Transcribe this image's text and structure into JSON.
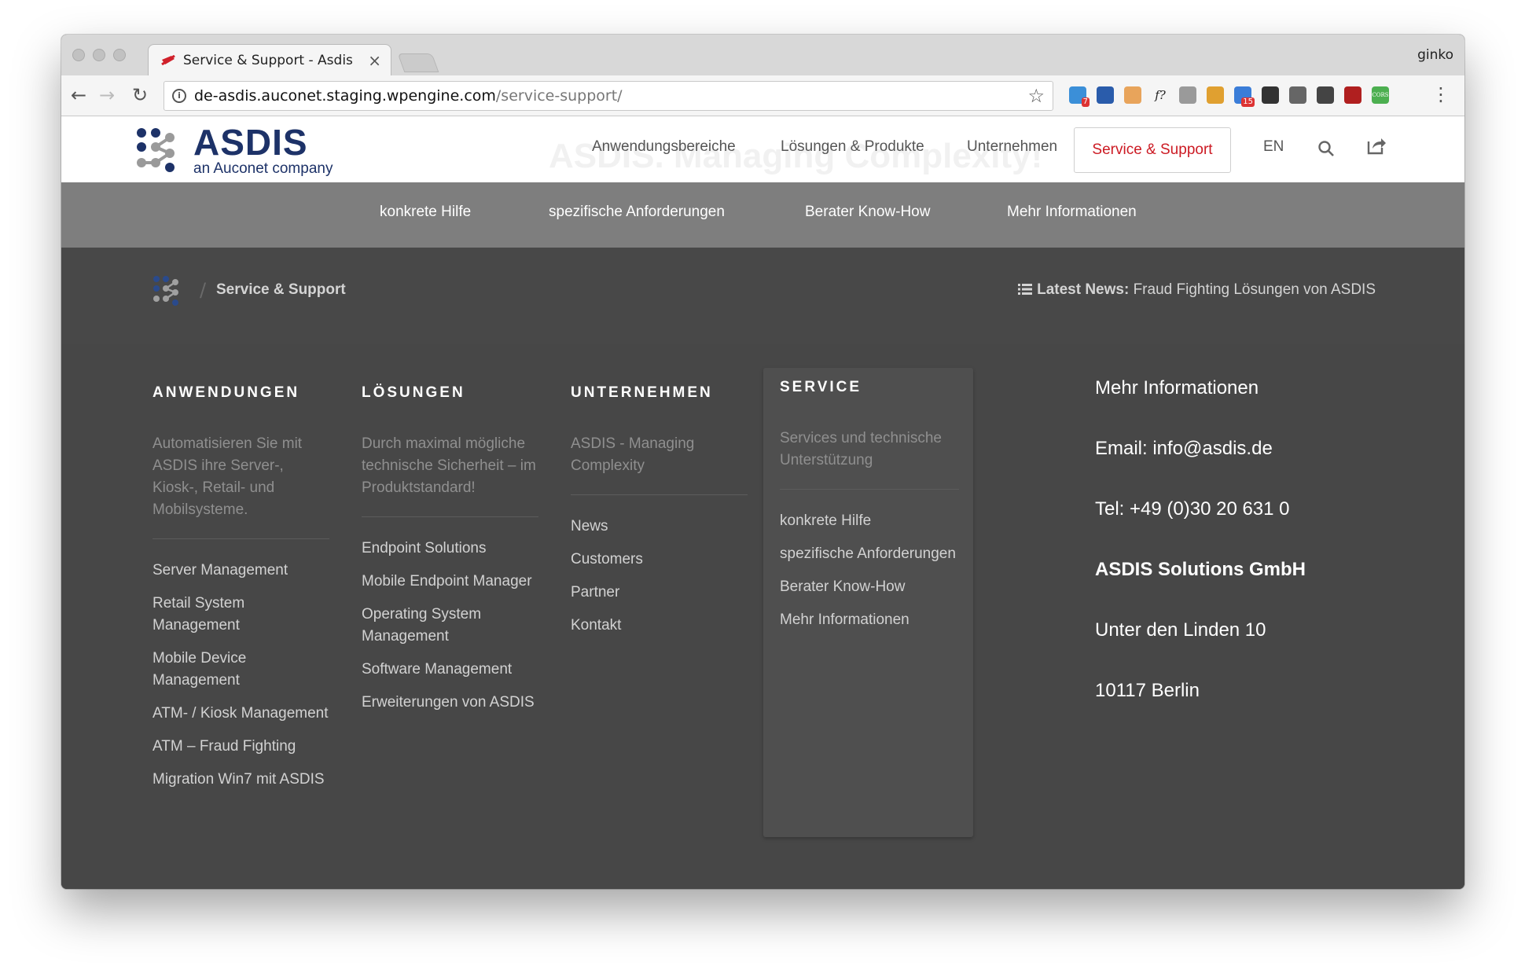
{
  "browser": {
    "tab_title": "Service & Support - Asdis",
    "tab_close": "×",
    "profile_name": "ginko",
    "url_host": "de-asdis.auconet.staging.wpengine.com",
    "url_path": "/service-support/",
    "nav": {
      "back": "←",
      "forward": "→",
      "reload": "↻",
      "star": "☆",
      "menu": "⋮"
    },
    "extensions": [
      {
        "name": "extension-badge-7-icon",
        "color": "#3b8fd8",
        "badge": "7"
      },
      {
        "name": "extension-delicious-icon",
        "color": "#2a5cab"
      },
      {
        "name": "extension-face-icon",
        "color": "#e8a45b"
      },
      {
        "name": "extension-fonts-icon",
        "color": "#f5f5f5",
        "label": "f?"
      },
      {
        "name": "extension-eyedropper-icon",
        "color": "#9a9a9a"
      },
      {
        "name": "extension-ruler-icon",
        "color": "#e0a030"
      },
      {
        "name": "extension-calendar-icon",
        "color": "#3b7dd8",
        "badge": "15"
      },
      {
        "name": "extension-github-icon",
        "color": "#333333"
      },
      {
        "name": "extension-cloud-icon",
        "color": "#666666"
      },
      {
        "name": "extension-lightbulb-icon",
        "color": "#444444"
      },
      {
        "name": "extension-shield-icon",
        "color": "#b01f1f"
      },
      {
        "name": "extension-cors-icon",
        "color": "#4caf50",
        "label": "CORS"
      }
    ]
  },
  "site": {
    "brand_color": "#1d3268",
    "accent_color": "#cc1a23",
    "logo": {
      "text": "ASDIS",
      "tagline": "an Auconet company"
    },
    "hero_ghost": "ASDIS. Managing Complexity!",
    "main_nav": {
      "items": [
        "Anwendungsbereiche",
        "Lösungen & Produkte",
        "Unternehmen"
      ],
      "active": "Service & Support",
      "lang": "EN"
    },
    "sub_nav": [
      "konkrete Hilfe",
      "spezifische Anforderungen",
      "Berater Know-How",
      "Mehr Informationen"
    ],
    "breadcrumb": {
      "current": "Service & Support"
    },
    "news": {
      "label": "Latest News:",
      "text": "Fraud Fighting Lösungen von ASDIS"
    }
  },
  "footer": {
    "columns": [
      {
        "title": "Anwendungen",
        "desc": "Automatisieren Sie mit ASDIS ihre Server-, Kiosk-, Retail- und Mobilsysteme.",
        "links": [
          "Server Management",
          "Retail System Management",
          "Mobile Device Management",
          "ATM- / Kiosk Management",
          "ATM – Fraud Fighting",
          "Migration Win7 mit ASDIS"
        ]
      },
      {
        "title": "Lösungen",
        "desc": "Durch maximal mögliche technische Sicherheit – im Produktstandard!",
        "links": [
          "Endpoint Solutions",
          "Mobile Endpoint Manager",
          "Operating System Management",
          "Software Management",
          "Erweiterungen von ASDIS"
        ]
      },
      {
        "title": "Unternehmen",
        "desc": "ASDIS - Managing Complexity",
        "links": [
          "News",
          "Customers",
          "Partner",
          "Kontakt"
        ]
      },
      {
        "title": "Service",
        "desc": "Services und technische Unterstützung",
        "links": [
          "konkrete Hilfe",
          "spezifische Anforderungen",
          "Berater Know-How",
          "Mehr Informationen"
        ]
      }
    ],
    "contact": {
      "heading": "Mehr Informationen",
      "email": "Email: info@asdis.de",
      "phone": "Tel: +49 (0)30 20 631 0",
      "company": "ASDIS Solutions GmbH",
      "street": "Unter den Linden 10",
      "city": "10117 Berlin"
    }
  }
}
